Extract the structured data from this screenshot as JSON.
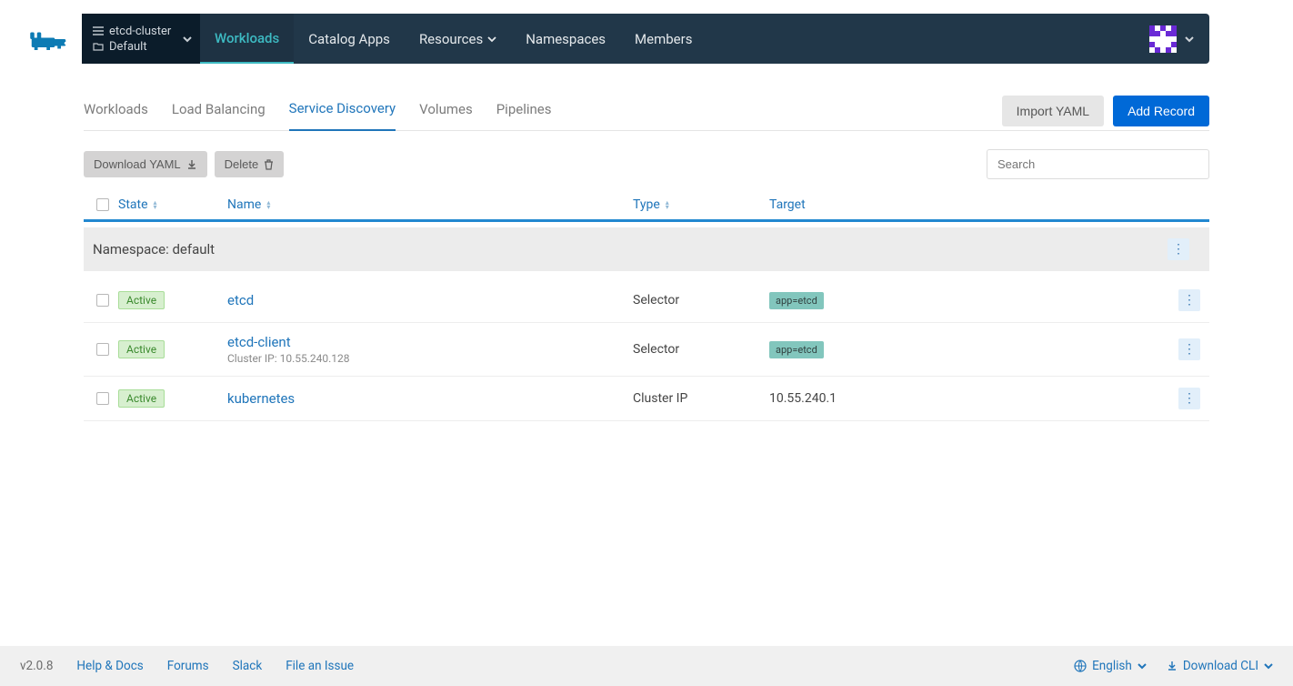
{
  "cluster": {
    "name": "etcd-cluster",
    "project": "Default"
  },
  "nav": {
    "items": [
      "Workloads",
      "Catalog Apps",
      "Resources",
      "Namespaces",
      "Members"
    ],
    "active": 0
  },
  "subtabs": {
    "items": [
      "Workloads",
      "Load Balancing",
      "Service Discovery",
      "Volumes",
      "Pipelines"
    ],
    "active": 2,
    "import_yaml": "Import YAML",
    "add_record": "Add Record"
  },
  "toolbar": {
    "download_yaml": "Download YAML",
    "delete": "Delete",
    "search_placeholder": "Search"
  },
  "columns": {
    "state": "State",
    "name": "Name",
    "type": "Type",
    "target": "Target"
  },
  "group": {
    "label": "Namespace: default"
  },
  "rows": [
    {
      "state": "Active",
      "name": "etcd",
      "subtitle": "",
      "type": "Selector",
      "target_label": "app=etcd",
      "target_text": ""
    },
    {
      "state": "Active",
      "name": "etcd-client",
      "subtitle": "Cluster IP: 10.55.240.128",
      "type": "Selector",
      "target_label": "app=etcd",
      "target_text": ""
    },
    {
      "state": "Active",
      "name": "kubernetes",
      "subtitle": "",
      "type": "Cluster IP",
      "target_label": "",
      "target_text": "10.55.240.1"
    }
  ],
  "footer": {
    "version": "v2.0.8",
    "help": "Help & Docs",
    "forums": "Forums",
    "slack": "Slack",
    "issue": "File an Issue",
    "language": "English",
    "download_cli": "Download CLI"
  }
}
